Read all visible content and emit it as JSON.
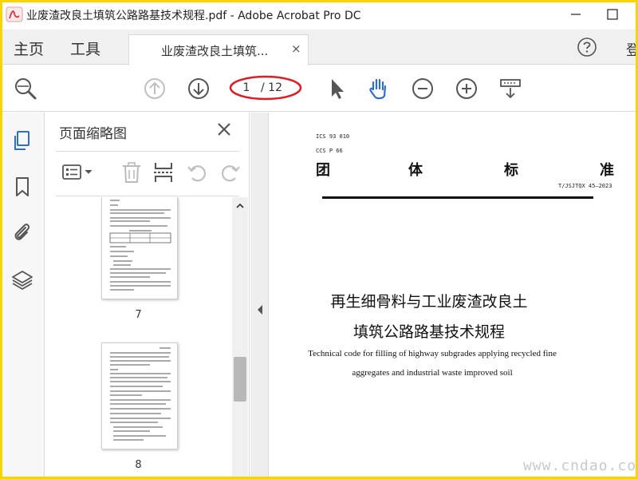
{
  "window": {
    "title": "业废渣改良土填筑公路路基技术规程.pdf - Adobe Acrobat Pro DC"
  },
  "tabs": {
    "home": "主页",
    "tools": "工具",
    "document": "业废渣改良土填筑...",
    "close": "×",
    "signin": "登"
  },
  "toolbar": {
    "page_current": "1",
    "page_total": "/ 12",
    "highlight_color": "#e01b24"
  },
  "thumbnails": {
    "title": "页面缩略图",
    "pages": [
      {
        "label": "7"
      },
      {
        "label": "8"
      }
    ]
  },
  "document": {
    "ics": "ICS 93 010",
    "ccs": "CCS P 66",
    "standard_chars": [
      "团",
      "体",
      "标",
      "准"
    ],
    "standard_code": "T/JSJTQX 45—2023",
    "title_line1": "再生细骨料与工业废渣改良土",
    "title_line2": "填筑公路路基技术规程",
    "en_line1": "Technical code for filling of highway subgrades applying recycled fine",
    "en_line2": "aggregates and industrial waste improved soil"
  },
  "watermark": "www.cndao.com",
  "colors": {
    "frame": "#f8d400",
    "accent_blue": "#2f6fc9",
    "icon_gray": "#555555"
  }
}
